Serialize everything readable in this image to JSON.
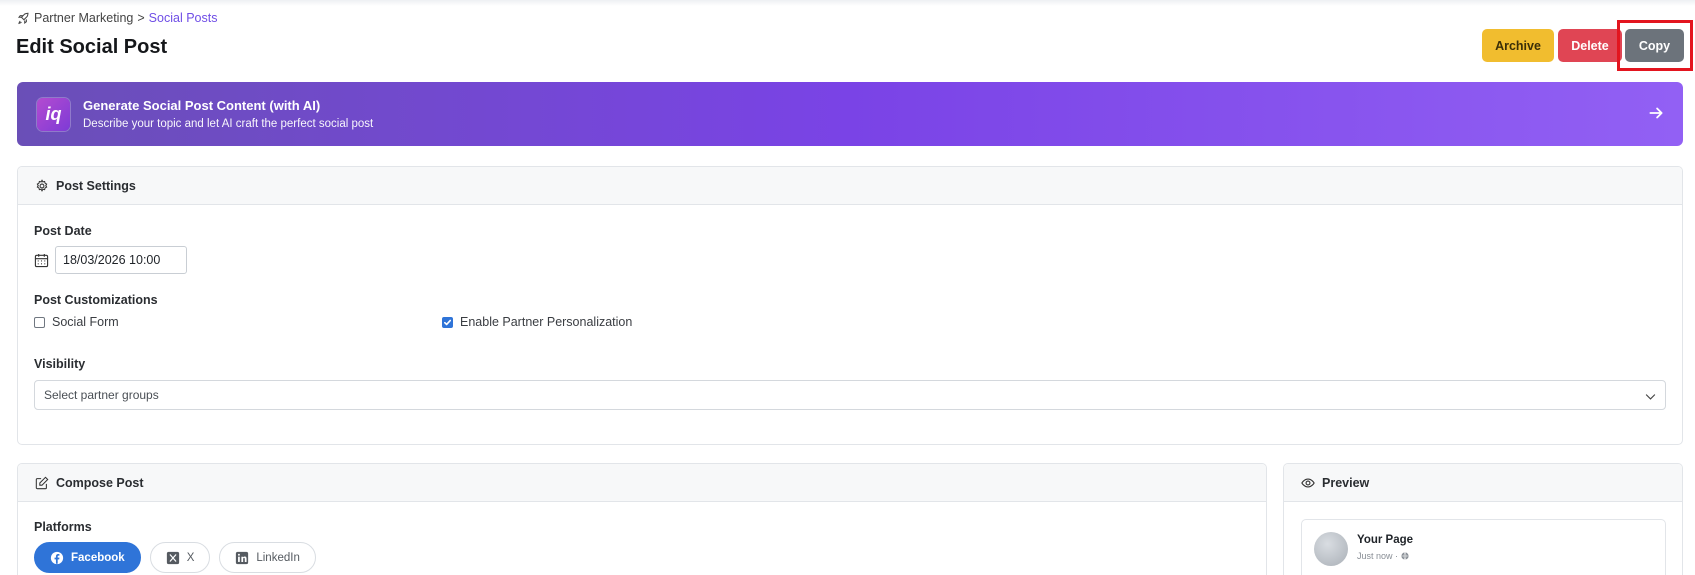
{
  "breadcrumb": {
    "parent": "Partner Marketing",
    "separator": ">",
    "current": "Social Posts"
  },
  "page_title": "Edit Social Post",
  "actions": {
    "archive": "Archive",
    "delete": "Delete",
    "copy": "Copy"
  },
  "ai_banner": {
    "title": "Generate Social Post Content (with AI)",
    "subtitle": "Describe your topic and let AI craft the perfect social post",
    "logo_text": "iq"
  },
  "settings": {
    "header": "Post Settings",
    "post_date_label": "Post Date",
    "post_date_value": "18/03/2026 10:00",
    "customizations_label": "Post Customizations",
    "social_form_label": "Social Form",
    "social_form_checked": false,
    "partner_personalization_label": "Enable Partner Personalization",
    "partner_personalization_checked": true,
    "visibility_label": "Visibility",
    "visibility_placeholder": "Select partner groups"
  },
  "compose": {
    "header": "Compose Post",
    "platforms_label": "Platforms",
    "platforms": [
      "Facebook",
      "X",
      "LinkedIn"
    ],
    "active_platform": "Facebook"
  },
  "preview": {
    "header": "Preview",
    "page_name": "Your Page",
    "time": "Just now ·"
  },
  "colors": {
    "accent_purple": "#7a43e6",
    "archive": "#f1bd2f",
    "delete": "#e04554",
    "copy": "#6c737b",
    "highlight": "#e3151f",
    "facebook_blue": "#2f74d8"
  }
}
